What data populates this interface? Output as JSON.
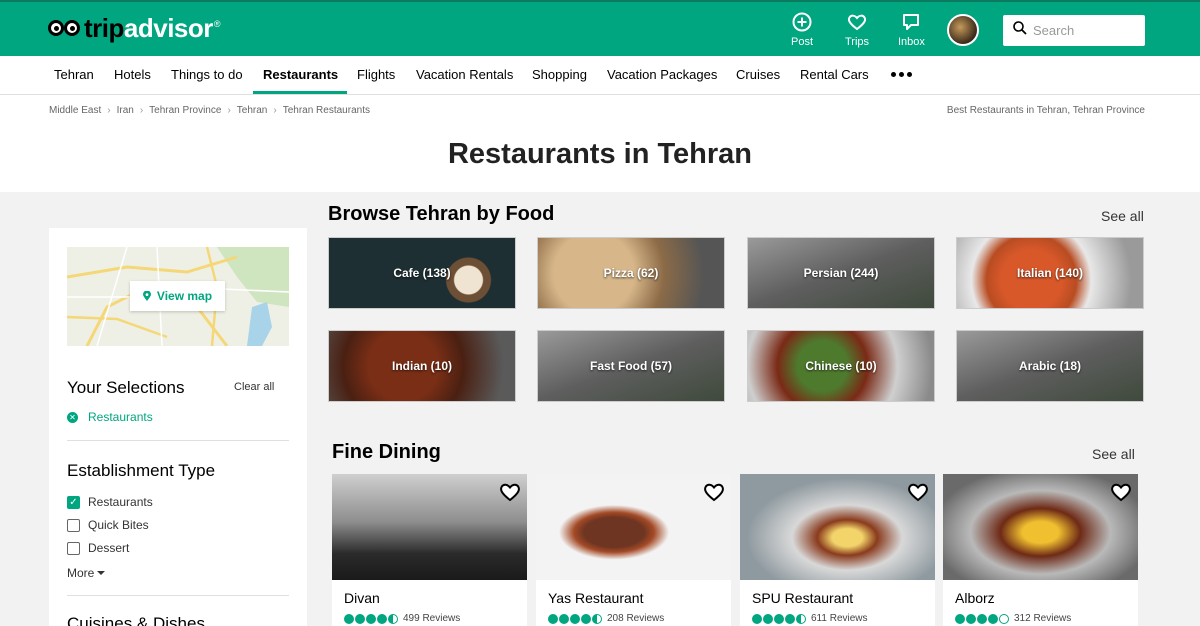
{
  "brand": {
    "logo_prefix": "trip",
    "logo_suffix": "advisor",
    "tm": "®"
  },
  "topnav": [
    {
      "label": "Post",
      "icon": "plus-circle-icon"
    },
    {
      "label": "Trips",
      "icon": "heart-icon"
    },
    {
      "label": "Inbox",
      "icon": "chat-icon"
    }
  ],
  "search": {
    "placeholder": "Search"
  },
  "subnav": {
    "items": [
      "Tehran",
      "Hotels",
      "Things to do",
      "Restaurants",
      "Flights",
      "Vacation Rentals",
      "Shopping",
      "Vacation Packages",
      "Cruises",
      "Rental Cars"
    ],
    "active": "Restaurants"
  },
  "breadcrumb": [
    "Middle East",
    "Iran",
    "Tehran Province",
    "Tehran",
    "Tehran Restaurants"
  ],
  "best_link": "Best Restaurants in Tehran, Tehran Province",
  "page_title": "Restaurants in Tehran",
  "sidebar": {
    "view_map": "View map",
    "selections_heading": "Your Selections",
    "clear_all": "Clear all",
    "selected": "Restaurants",
    "establishment_heading": "Establishment Type",
    "establishment_options": [
      {
        "label": "Restaurants",
        "checked": true
      },
      {
        "label": "Quick Bites",
        "checked": false
      },
      {
        "label": "Dessert",
        "checked": false
      }
    ],
    "more": "More",
    "next_heading": "Cuisines & Dishes"
  },
  "browse": {
    "heading": "Browse Tehran by Food",
    "see_all": "See all",
    "tiles": [
      {
        "label": "Cafe (138)"
      },
      {
        "label": "Pizza (62)"
      },
      {
        "label": "Persian (244)"
      },
      {
        "label": "Italian (140)"
      },
      {
        "label": "Indian (10)"
      },
      {
        "label": "Fast Food (57)"
      },
      {
        "label": "Chinese (10)"
      },
      {
        "label": "Arabic (18)"
      }
    ]
  },
  "fine_dining": {
    "heading": "Fine Dining",
    "see_all": "See all",
    "cards": [
      {
        "name": "Divan",
        "reviews": "499 Reviews",
        "rating": 4.5
      },
      {
        "name": "Yas Restaurant",
        "reviews": "208 Reviews",
        "rating": 4.5
      },
      {
        "name": "SPU Restaurant",
        "reviews": "611 Reviews",
        "rating": 4.5
      },
      {
        "name": "Alborz",
        "reviews": "312 Reviews",
        "rating": 4.0
      }
    ]
  },
  "colors": {
    "brand_green": "#00a680",
    "dark_green": "#0b7a5f"
  }
}
